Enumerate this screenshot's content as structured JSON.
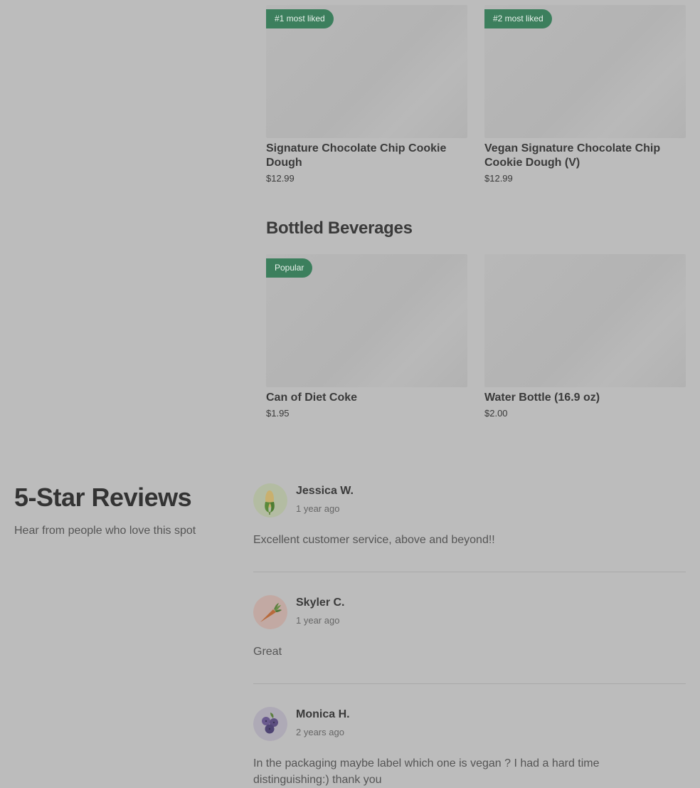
{
  "menu": {
    "items": [
      {
        "badge": "#1 most liked",
        "name": "Signature Chocolate Chip Cookie Dough",
        "price": "$12.99"
      },
      {
        "badge": "#2 most liked",
        "name": "Vegan Signature Chocolate Chip Cookie Dough (V)",
        "price": "$12.99"
      }
    ]
  },
  "beverages": {
    "title": "Bottled Beverages",
    "items": [
      {
        "badge": "Popular",
        "name": "Can of Diet Coke",
        "price": "$1.95"
      },
      {
        "name": "Water Bottle (16.9 oz)",
        "price": "$2.00"
      }
    ]
  },
  "reviews": {
    "title": "5-Star Reviews",
    "subtitle": "Hear from people who love this spot",
    "items": [
      {
        "name": "Jessica W.",
        "time": "1 year ago",
        "text": "Excellent customer service, above and beyond!!",
        "avatar_icon": "corn-icon"
      },
      {
        "name": "Skyler C.",
        "time": "1 year ago",
        "text": "Great",
        "avatar_icon": "carrot-icon"
      },
      {
        "name": "Monica H.",
        "time": "2 years ago",
        "text": "In the packaging maybe label which one is vegan ? I had a hard time distinguishing:) thank you",
        "avatar_icon": "blueberries-icon"
      }
    ]
  },
  "colors": {
    "overlay_background": "#bcbcbc",
    "badge_green": "#3c7f5d"
  }
}
